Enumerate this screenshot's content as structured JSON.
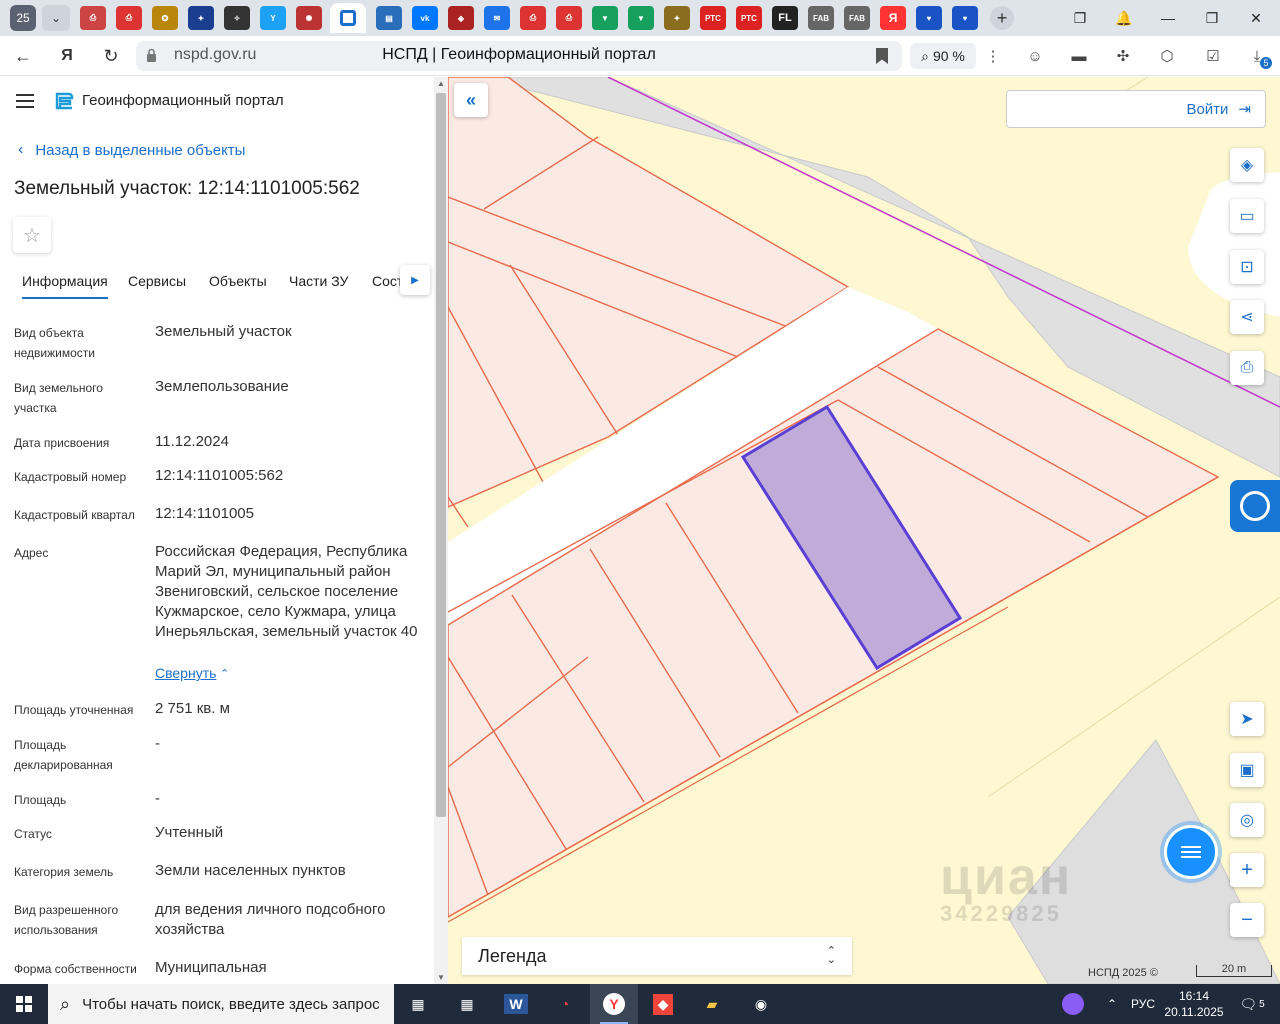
{
  "browser": {
    "tab_count": "25",
    "active_tab_icon": "geoportal-icon",
    "url_domain": "nspd.gov.ru",
    "page_title": "НСПД | Геоинформационный портал",
    "zoom": "90 %",
    "downloads_badge": "5"
  },
  "tabs_icons": [
    "pdf-icon",
    "pdf-icon",
    "seal-icon",
    "emblem-icon",
    "seal-icon",
    "twitter-icon",
    "ornament-icon",
    "news-icon",
    "vk-icon",
    "shield-icon",
    "mail-icon",
    "pdf-icon",
    "pdf-icon",
    "shield-green-icon",
    "shield-green-icon",
    "emblem-icon",
    "rts-icon",
    "rts-icon",
    "fl-icon",
    "fabrikant-icon",
    "fabrikant-icon",
    "yandex-icon",
    "heart-icon",
    "heart-icon"
  ],
  "tab_labels": {
    "rts1": "РТС",
    "rts2": "РТС",
    "fl": "FL",
    "fab1": "FAB",
    "fab2": "FAB",
    "ya": "Я"
  },
  "app": {
    "portal_title": "Геоинформационный портал",
    "back_link": "Назад в выделенные объекты",
    "object_title": "Земельный участок: 12:14:1101005:562",
    "star_glyph": "☆",
    "tabs": [
      "Информация",
      "Сервисы",
      "Объекты",
      "Части ЗУ",
      "Соста"
    ],
    "collapse_label": "Свернуть",
    "fields": [
      {
        "label": "Вид объекта недвижимости",
        "value": "Земельный участок"
      },
      {
        "label": "Вид земельного участка",
        "value": "Землепользование"
      },
      {
        "label": "Дата присвоения",
        "value": "11.12.2024"
      },
      {
        "label": "Кадастровый номер",
        "value": "12:14:1101005:562"
      },
      {
        "label": "Кадастровый квартал",
        "value": "12:14:1101005"
      },
      {
        "label": "Адрес",
        "value": "Российская Федерация, Республика Марий Эл, муниципальный район Звениговский, сельское поселение Кужмарское, село Кужмара, улица Инерьяльская, земельный участок 40"
      },
      {
        "label": "Площадь уточненная",
        "value": "2 751 кв. м"
      },
      {
        "label": "Площадь декларированная",
        "value": "-"
      },
      {
        "label": "Площадь",
        "value": "-"
      },
      {
        "label": "Статус",
        "value": "Учтенный"
      },
      {
        "label": "Категория земель",
        "value": "Земли населенных пунктов"
      },
      {
        "label": "Вид разрешенного использования",
        "value": "для ведения личного подсобного хозяйства"
      },
      {
        "label": "Форма собственности",
        "value": "Муниципальная"
      }
    ]
  },
  "map": {
    "login_label": "Войти",
    "legend_label": "Легенда",
    "copyright": "НСПД 2025 ©",
    "scale": "20 m",
    "watermark_brand": "циан",
    "watermark_id": "34229825",
    "colors": {
      "parcel_fill": "#fbe9e4",
      "parcel_stroke": "#e86b4d",
      "selected_fill": "#c0acd8",
      "selected_stroke": "#5a3fd4",
      "road": "#e0e0e0",
      "accent": "#1c6fc9"
    }
  },
  "taskbar": {
    "search_placeholder": "Чтобы начать поиск, введите здесь запрос",
    "lang": "РУС",
    "time": "16:14",
    "date": "20.11.2025",
    "notifications": "5"
  }
}
